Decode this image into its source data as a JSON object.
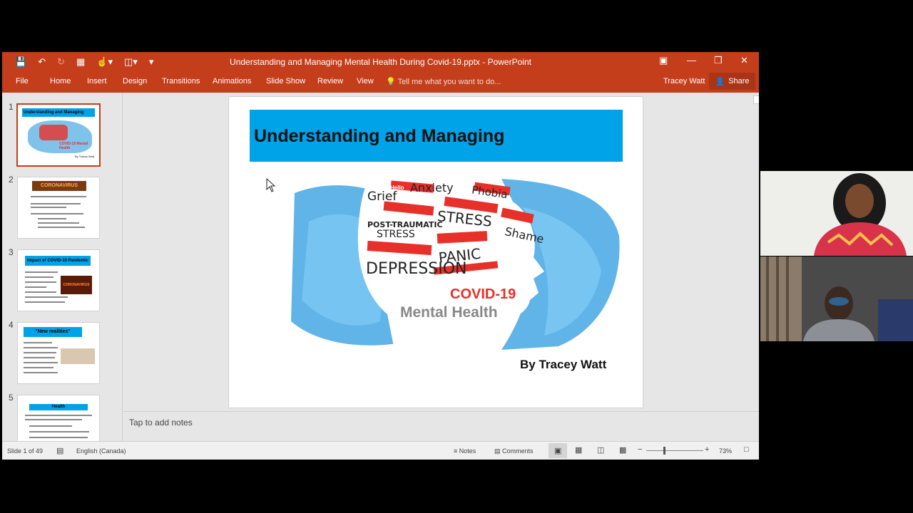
{
  "window": {
    "title": "Understanding and Managing Mental  Health During Covid-19.pptx  -  PowerPoint"
  },
  "ribbon": {
    "tabs": [
      "File",
      "Home",
      "Insert",
      "Design",
      "Transitions",
      "Animations",
      "Slide Show",
      "Review",
      "View"
    ],
    "tell_me": "Tell me what you want to do...",
    "user": "Tracey Watt",
    "share": "Share"
  },
  "thumbnails": [
    {
      "num": "1",
      "title": "Understanding and Managing",
      "sub": "COVID-19 Mental Health",
      "by": "By Tracey Watt"
    },
    {
      "num": "2",
      "title": "CORONAVIRUS"
    },
    {
      "num": "3",
      "title": "Impact of COVID-19 Pandemic",
      "image": "CORONAVIRUS"
    },
    {
      "num": "4",
      "title": "\"New realities\""
    },
    {
      "num": "5",
      "title": "Health"
    }
  ],
  "slide": {
    "title": "Understanding and Managing",
    "image_words": [
      "Hello",
      "Grief",
      "Anxiety",
      "Phobia",
      "POST-TRAUMATIC",
      "STRESS",
      "STRESS",
      "Shame",
      "PANIC",
      "DEPRESSION"
    ],
    "covid": "COVID-19",
    "mental": "Mental Health",
    "byline": "By Tracey Watt"
  },
  "notes": {
    "placeholder": "Tap to add notes"
  },
  "status": {
    "slide_of": "Slide 1 of 49",
    "language": "English (Canada)",
    "notes": "Notes",
    "comments": "Comments",
    "zoom": "73%"
  },
  "colors": {
    "accent": "#c43e1c",
    "banner": "#00a2e8",
    "covid_red": "#e8302a"
  }
}
